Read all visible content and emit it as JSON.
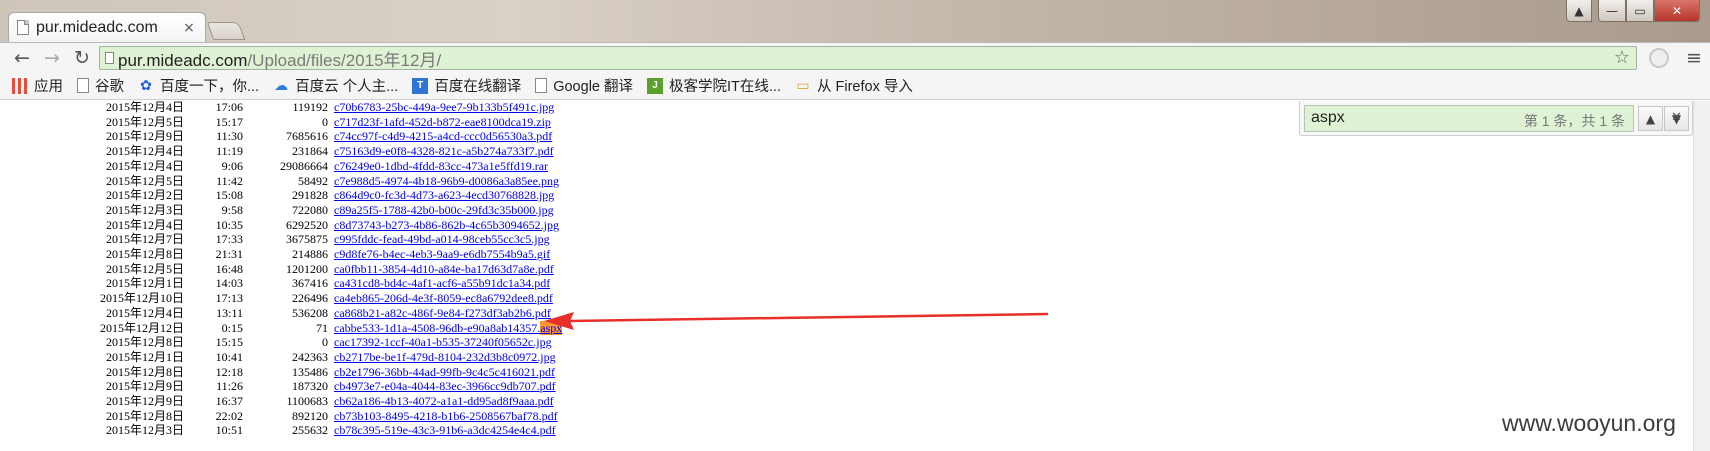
{
  "window": {
    "tab_title": "pur.mideadc.com",
    "tab_close": "×",
    "controls": {
      "min": "—",
      "max": "▭",
      "close": "✕",
      "user": "▲"
    }
  },
  "toolbar": {
    "back": "←",
    "forward": "→",
    "reload": "↻",
    "url_host": "pur.mideadc.com",
    "url_path": "/Upload/files/2015年12月/",
    "star": "☆",
    "menu": "≡"
  },
  "bookmarks": [
    {
      "label": "应用",
      "icon": "apps-icon"
    },
    {
      "label": "谷歌",
      "icon": "page-icon"
    },
    {
      "label": "百度一下，你...",
      "icon": "paw-icon"
    },
    {
      "label": "百度云 个人主...",
      "icon": "cloud-icon"
    },
    {
      "label": "百度在线翻译",
      "icon": "translate-icon"
    },
    {
      "label": "Google 翻译",
      "icon": "page-icon"
    },
    {
      "label": "极客学院IT在线...",
      "icon": "jikexueyuan-icon"
    },
    {
      "label": "从 Firefox 导入",
      "icon": "folder-icon"
    }
  ],
  "find": {
    "query": "aspx",
    "count": "第 1 条，共 1 条",
    "prev": "▲",
    "next": "▼",
    "close": "✕"
  },
  "listing": [
    {
      "date": "2015年12月4日",
      "time": "17:06",
      "size": "119192",
      "name": "c70b6783-25bc-449a-9ee7-9b133b5f491c.jpg"
    },
    {
      "date": "2015年12月5日",
      "time": "15:17",
      "size": "0",
      "name": "c717d23f-1afd-452d-b872-eae8100dca19.zip"
    },
    {
      "date": "2015年12月9日",
      "time": "11:30",
      "size": "7685616",
      "name": "c74cc97f-c4d9-4215-a4cd-ccc0d56530a3.pdf"
    },
    {
      "date": "2015年12月4日",
      "time": "11:19",
      "size": "231864",
      "name": "c75163d9-e0f8-4328-821c-a5b274a733f7.pdf"
    },
    {
      "date": "2015年12月4日",
      "time": "9:06",
      "size": "29086664",
      "name": "c76249e0-1dbd-4fdd-83cc-473a1e5ffd19.rar"
    },
    {
      "date": "2015年12月5日",
      "time": "11:42",
      "size": "58492",
      "name": "c7e988d5-4974-4b18-96b9-d0086a3a85ee.png"
    },
    {
      "date": "2015年12月2日",
      "time": "15:08",
      "size": "291828",
      "name": "c864d9c0-fc3d-4d73-a623-4ecd30768828.jpg"
    },
    {
      "date": "2015年12月3日",
      "time": "9:58",
      "size": "722080",
      "name": "c89a25f5-1788-42b0-b00c-29fd3c35b000.jpg"
    },
    {
      "date": "2015年12月4日",
      "time": "10:35",
      "size": "6292520",
      "name": "c8d73743-b273-4b86-862b-4c65b3094652.jpg"
    },
    {
      "date": "2015年12月7日",
      "time": "17:33",
      "size": "3675875",
      "name": "c995fddc-fead-49bd-a014-98ceb55cc3c5.jpg"
    },
    {
      "date": "2015年12月8日",
      "time": "21:31",
      "size": "214886",
      "name": "c9d8fe76-b4ec-4eb3-9aa9-e6db7554b9a5.gif"
    },
    {
      "date": "2015年12月5日",
      "time": "16:48",
      "size": "1201200",
      "name": "ca0fbb11-3854-4d10-a84e-ba17d63d7a8e.pdf"
    },
    {
      "date": "2015年12月1日",
      "time": "14:03",
      "size": "367416",
      "name": "ca431cd8-bd4c-4af1-acf6-a55b91dc1a34.pdf"
    },
    {
      "date": "2015年12月10日",
      "time": "17:13",
      "size": "226496",
      "name": "ca4eb865-206d-4e3f-8059-ec8a6792dee8.pdf"
    },
    {
      "date": "2015年12月4日",
      "time": "13:11",
      "size": "536208",
      "name": "ca868b21-a82c-486f-9e84-f273df3ab2b6.pdf"
    },
    {
      "date": "2015年12月12日",
      "time": "0:15",
      "size": "71",
      "name": "cabbe533-1d1a-4508-96db-e90a8ab14357.",
      "highlight": "aspx"
    },
    {
      "date": "2015年12月8日",
      "time": "15:15",
      "size": "0",
      "name": "cac17392-1ccf-40a1-b535-37240f05652c.jpg"
    },
    {
      "date": "2015年12月1日",
      "time": "10:41",
      "size": "242363",
      "name": "cb2717be-be1f-479d-8104-232d3b8c0972.jpg"
    },
    {
      "date": "2015年12月8日",
      "time": "12:18",
      "size": "135486",
      "name": "cb2e1796-36bb-44ad-99fb-9c4c5c416021.pdf"
    },
    {
      "date": "2015年12月9日",
      "time": "11:26",
      "size": "187320",
      "name": "cb4973e7-e04a-4044-83ec-3966cc9db707.pdf"
    },
    {
      "date": "2015年12月9日",
      "time": "16:37",
      "size": "1100683",
      "name": "cb62a186-4b13-4072-a1a1-dd95ad8f9aaa.pdf"
    },
    {
      "date": "2015年12月8日",
      "time": "22:02",
      "size": "892120",
      "name": "cb73b103-8495-4218-b1b6-2508567baf78.pdf"
    },
    {
      "date": "2015年12月3日",
      "time": "10:51",
      "size": "255632",
      "name": "cb78c395-519e-43c3-91b6-a3dc4254e4c4.pdf"
    }
  ],
  "annotation": {
    "arrow_color": "#e8302a"
  },
  "watermark": "www.wooyun.org"
}
